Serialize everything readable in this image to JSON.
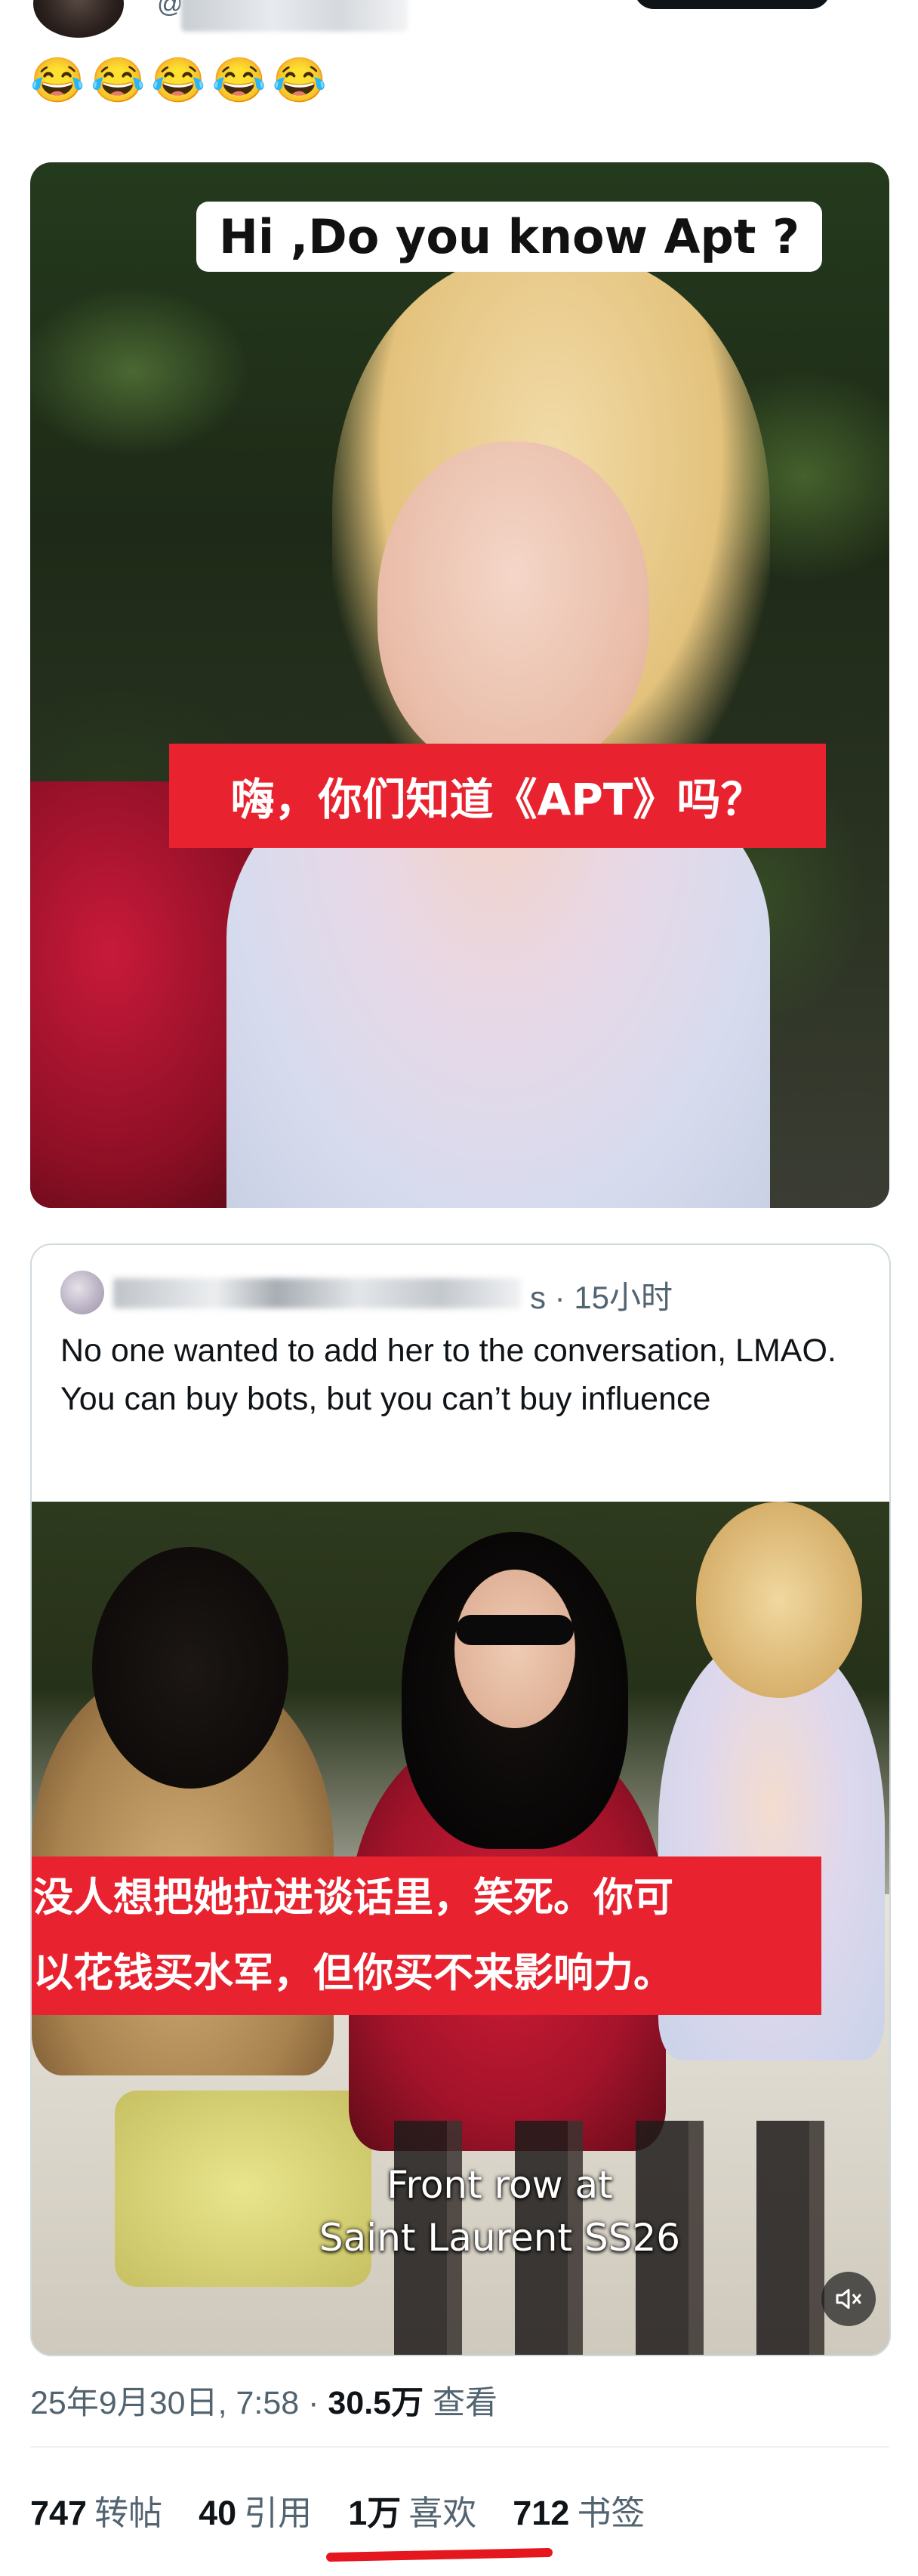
{
  "header": {
    "handle_prefix": "@",
    "emojis": "😂😂😂😂😂"
  },
  "media1": {
    "caption_en": "Hi ,Do you know Apt ?",
    "caption_zh": "嗨，你们知道《APT》吗？"
  },
  "quote": {
    "name_suffix": "s",
    "time": "· 15小时",
    "text": "No one wanted to add her to the conversation, LMAO. You can buy bots, but you can’t buy influence",
    "media": {
      "caption_zh_line1": "没人想把她拉进谈话里，笑死。你可",
      "caption_zh_line2": "以花钱买水军，但你买不来影响力。",
      "overlay_line1": "Front row at",
      "overlay_line2": "Saint Laurent SS26",
      "mute_icon": "speaker-muted-icon"
    }
  },
  "meta": {
    "date_time": "25年9月30日, 7:58 ·",
    "views_count": "30.5万",
    "views_label": "查看"
  },
  "stats": {
    "retweets_count": "747",
    "retweets_label": "转帖",
    "quotes_count": "40",
    "quotes_label": "引用",
    "likes_count": "1万",
    "likes_label": "喜欢",
    "bookmarks_count": "712",
    "bookmarks_label": "书签"
  },
  "colors": {
    "caption_red": "#e8232f",
    "underline_red": "#e6161e",
    "secondary_text": "#536471"
  }
}
